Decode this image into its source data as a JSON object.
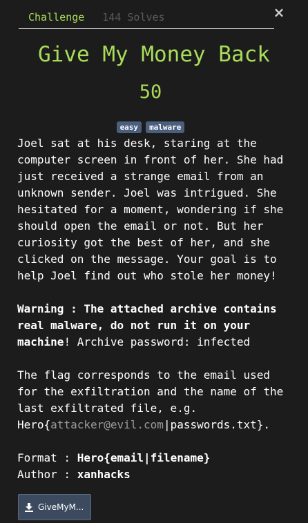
{
  "tabs": {
    "challenge": "Challenge",
    "solves": "144 Solves"
  },
  "close_icon": "×",
  "challenge": {
    "title": "Give My Money Back",
    "points": "50",
    "tags": [
      "easy",
      "malware"
    ]
  },
  "description": {
    "intro": "Joel sat at his desk, staring at the computer screen in front of her. She had just received a strange email from an unknown sender. Joel was intrigued. She hesitated for a moment, wondering if she should open the email or not. But her curiosity got the best of her, and she clicked on the message. Your goal is to help Joel find out who stole her money!",
    "warning_bold": "Warning : The attached archive contains real malware, do not run it on your machine",
    "warning_excl": "!",
    "password_text": " Archive password: infected",
    "flag_text": "The flag corresponds to the email used for the exfiltration and the name of the last exfiltrated file, e.g. Hero{",
    "flag_example_email": "attacker@evil.com",
    "flag_text_end": "|passwords.txt}.",
    "format_label": "Format : ",
    "format_value": "Hero{email|filename}",
    "author_label": "Author : ",
    "author_value": "xanhacks"
  },
  "download": {
    "label": "GiveMyM...",
    "icon": "download-icon"
  },
  "colors": {
    "accent": "#a8dc5a",
    "background": "#1c1c1c",
    "tag": "#4a5f7d",
    "button": "#3b4a5e"
  }
}
